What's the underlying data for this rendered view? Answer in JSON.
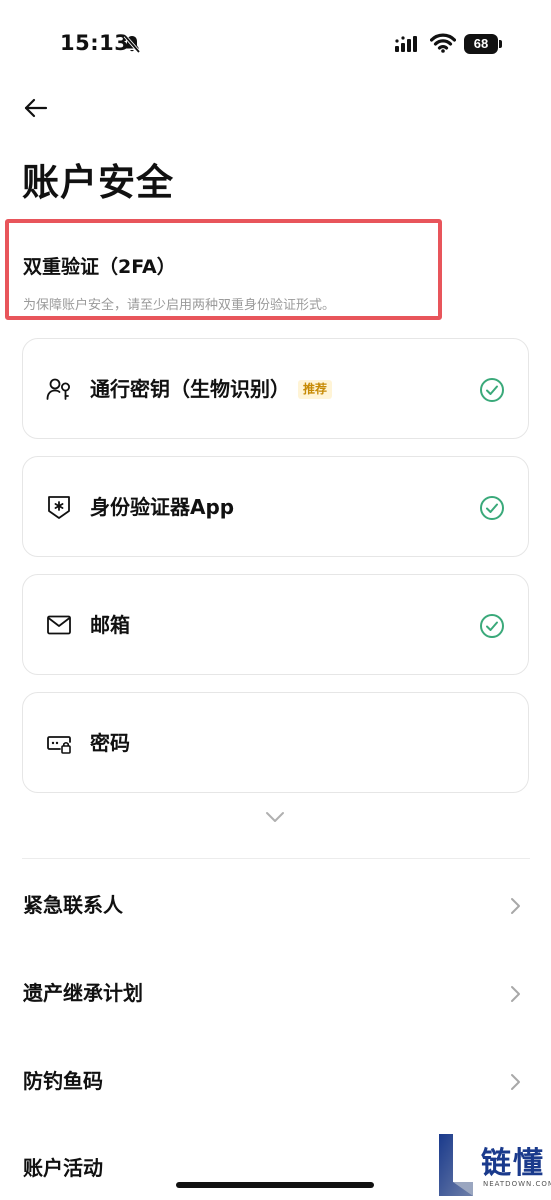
{
  "status_bar": {
    "time": "15:13",
    "battery": "68"
  },
  "header": {
    "title": "账户安全"
  },
  "two_factor": {
    "title": "双重验证（2FA）",
    "description": "为保障账户安全，请至少启用两种双重身份验证形式。",
    "methods": [
      {
        "label": "通行密钥（生物识别）",
        "badge": "推荐",
        "icon": "passkey-icon",
        "enabled": true
      },
      {
        "label": "身份验证器App",
        "icon": "authenticator-icon",
        "enabled": true
      },
      {
        "label": "邮箱",
        "icon": "mail-icon",
        "enabled": true
      },
      {
        "label": "密码",
        "icon": "password-icon",
        "enabled": false
      }
    ]
  },
  "menu": [
    {
      "label": "紧急联系人"
    },
    {
      "label": "遗产继承计划"
    },
    {
      "label": "防钓鱼码"
    },
    {
      "label": "账户活动"
    }
  ],
  "watermark": {
    "text": "链懂",
    "sub": "NEATDOWN.COM"
  },
  "colors": {
    "check": "#3aa97a",
    "badge_text": "#c78a05",
    "badge_bg": "#fff4d6",
    "highlight": "#e8555b"
  }
}
